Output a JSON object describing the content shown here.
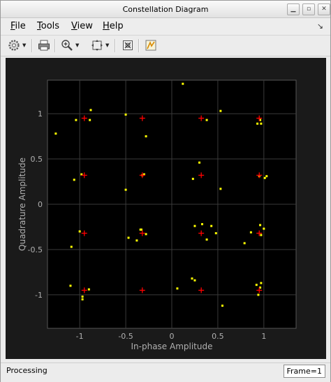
{
  "window": {
    "title": "Constellation Diagram"
  },
  "menu": {
    "items": [
      {
        "label": "File",
        "underline": "F",
        "rest": "ile"
      },
      {
        "label": "Tools",
        "underline": "T",
        "rest": "ools"
      },
      {
        "label": "View",
        "underline": "V",
        "rest": "iew"
      },
      {
        "label": "Help",
        "underline": "H",
        "rest": "elp"
      }
    ]
  },
  "toolbar": {
    "icons": [
      "settings-gear-icon",
      "print-icon",
      "zoom-in-icon",
      "autoscale-icon",
      "scale-axes-icon",
      "highlight-icon"
    ]
  },
  "colors": {
    "background": "#000000",
    "figure": "#1a1a1a",
    "grid": "#3a3a3a",
    "received": "#ffff00",
    "reference": "#ff0000",
    "text": "#b0b0b0"
  },
  "chart_data": {
    "type": "scatter",
    "title": "",
    "xlabel": "In-phase Amplitude",
    "ylabel": "Quadrature Amplitude",
    "xlim": [
      -1.35,
      1.35
    ],
    "ylim": [
      -1.37,
      1.37
    ],
    "xticks": [
      -1,
      -0.5,
      0,
      0.5,
      1
    ],
    "yticks": [
      -1,
      -0.5,
      0,
      0.5,
      1
    ],
    "xtick_labels": [
      "-1",
      "-0.5",
      "0",
      "0.5",
      "1"
    ],
    "ytick_labels": [
      "-1",
      "-0.5",
      "0",
      "0.5",
      "1"
    ],
    "grid": true,
    "series": [
      {
        "marker": "+",
        "color": "#ff0000",
        "points": [
          [
            -0.95,
            0.95
          ],
          [
            -0.32,
            0.95
          ],
          [
            0.32,
            0.95
          ],
          [
            0.95,
            0.95
          ],
          [
            -0.95,
            0.32
          ],
          [
            -0.32,
            0.32
          ],
          [
            0.32,
            0.32
          ],
          [
            0.95,
            0.32
          ],
          [
            -0.95,
            -0.32
          ],
          [
            -0.32,
            -0.32
          ],
          [
            0.32,
            -0.32
          ],
          [
            0.95,
            -0.32
          ],
          [
            -0.95,
            -0.95
          ],
          [
            -0.32,
            -0.95
          ],
          [
            0.32,
            -0.95
          ],
          [
            0.95,
            -0.95
          ]
        ]
      },
      {
        "marker": "square",
        "color": "#ffff00",
        "points": [
          [
            -1.26,
            0.78
          ],
          [
            -1.04,
            0.93
          ],
          [
            -0.88,
            1.04
          ],
          [
            -0.89,
            0.93
          ],
          [
            -0.5,
            0.99
          ],
          [
            -0.28,
            0.75
          ],
          [
            0.12,
            1.33
          ],
          [
            0.38,
            0.93
          ],
          [
            0.53,
            1.03
          ],
          [
            0.93,
            0.89
          ],
          [
            0.97,
            0.89
          ],
          [
            0.96,
            0.93
          ],
          [
            -1.06,
            0.27
          ],
          [
            -0.98,
            0.33
          ],
          [
            -0.5,
            0.16
          ],
          [
            -0.32,
            0.32
          ],
          [
            -0.3,
            0.33
          ],
          [
            0.23,
            0.28
          ],
          [
            0.3,
            0.46
          ],
          [
            0.53,
            0.17
          ],
          [
            0.95,
            0.31
          ],
          [
            1.01,
            0.29
          ],
          [
            1.03,
            0.31
          ],
          [
            -1.0,
            -0.3
          ],
          [
            -1.09,
            -0.47
          ],
          [
            -0.34,
            -0.28
          ],
          [
            -0.33,
            -0.28
          ],
          [
            -0.28,
            -0.33
          ],
          [
            -0.47,
            -0.37
          ],
          [
            -0.38,
            -0.4
          ],
          [
            0.25,
            -0.24
          ],
          [
            0.33,
            -0.22
          ],
          [
            0.38,
            -0.39
          ],
          [
            0.43,
            -0.24
          ],
          [
            0.48,
            -0.32
          ],
          [
            0.79,
            -0.43
          ],
          [
            0.86,
            -0.31
          ],
          [
            0.96,
            -0.23
          ],
          [
            1.0,
            -0.27
          ],
          [
            0.97,
            -0.34
          ],
          [
            -1.1,
            -0.9
          ],
          [
            -0.97,
            -1.02
          ],
          [
            -0.97,
            -1.05
          ],
          [
            -0.9,
            -0.94
          ],
          [
            0.06,
            -0.93
          ],
          [
            0.22,
            -0.82
          ],
          [
            0.25,
            -0.84
          ],
          [
            0.55,
            -1.12
          ],
          [
            0.92,
            -0.89
          ],
          [
            0.96,
            -0.92
          ],
          [
            0.97,
            -0.87
          ],
          [
            0.94,
            -1.0
          ]
        ]
      }
    ]
  },
  "status": {
    "left": "Processing",
    "right": "Frame=1"
  }
}
